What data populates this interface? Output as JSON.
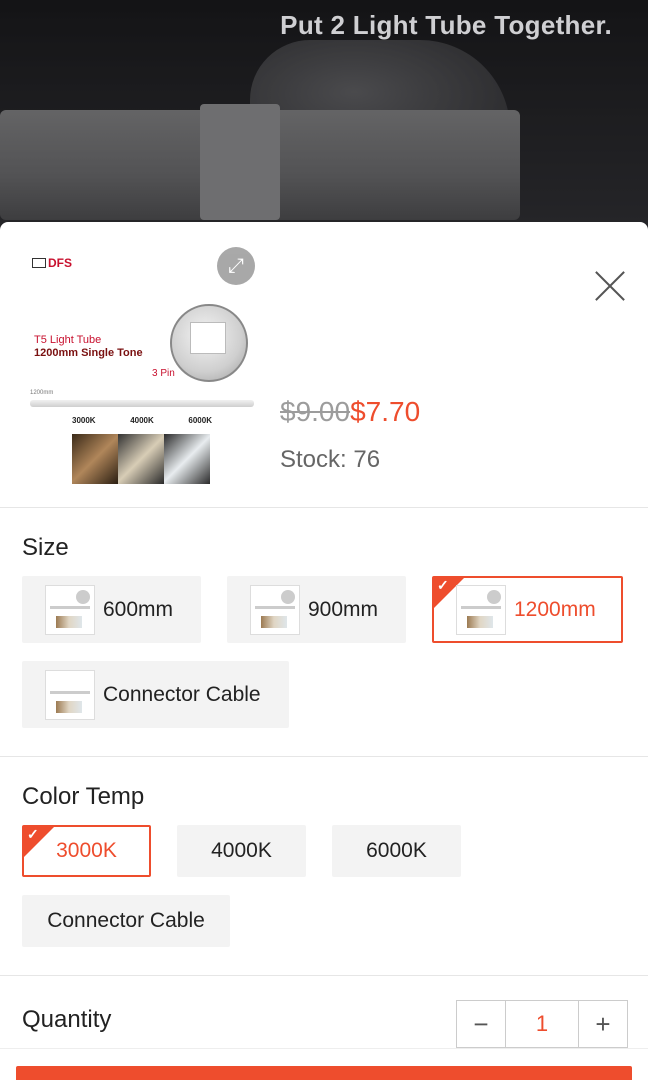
{
  "video": {
    "caption": "Put 2 Light Tube Together."
  },
  "product": {
    "thumb": {
      "brand": "DFS",
      "line1": "T5 Light Tube",
      "line2": "1200mm Single Tone",
      "pin": "3 Pin",
      "length": "1200mm",
      "kelvins": [
        "3000K",
        "4000K",
        "6000K"
      ]
    },
    "price_old": "$9.00",
    "price_new": "$7.70",
    "stock": "Stock: 76"
  },
  "size": {
    "title": "Size",
    "options": [
      {
        "label": "600mm",
        "selected": false
      },
      {
        "label": "900mm",
        "selected": false
      },
      {
        "label": "1200mm",
        "selected": true
      },
      {
        "label": "Connector Cable",
        "selected": false
      }
    ]
  },
  "color_temp": {
    "title": "Color Temp",
    "options": [
      {
        "label": "3000K",
        "selected": true
      },
      {
        "label": "4000K",
        "selected": false
      },
      {
        "label": "6000K",
        "selected": false
      },
      {
        "label": "Connector Cable",
        "selected": false
      }
    ]
  },
  "quantity": {
    "label": "Quantity",
    "value": "1",
    "minus": "−",
    "plus": "+"
  },
  "colors": {
    "accent": "#ee4d2d"
  },
  "icons": {
    "expand": "expand-icon",
    "close": "close-icon",
    "check": "check-icon"
  }
}
